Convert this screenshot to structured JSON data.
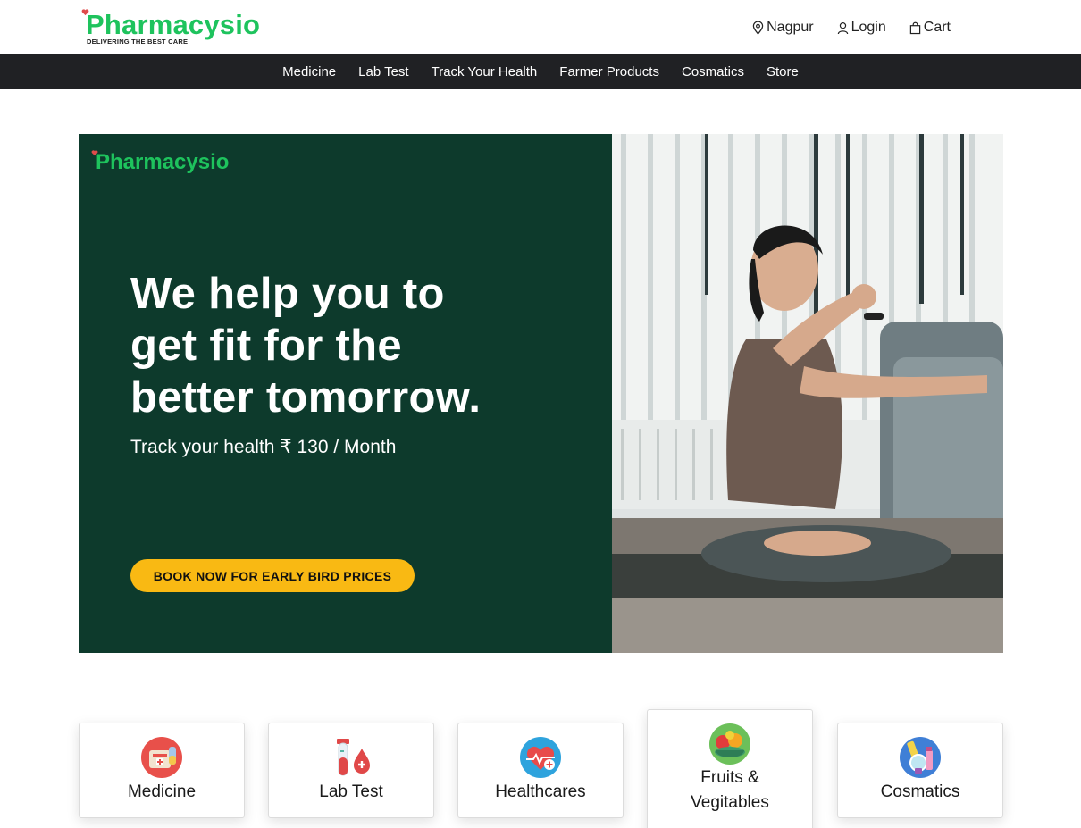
{
  "brand": {
    "name": "Pharmacysio",
    "tagline": "DELIVERING THE BEST CARE"
  },
  "top_actions": {
    "location": "Nagpur",
    "login": "Login",
    "cart": "Cart"
  },
  "nav": {
    "items": [
      "Medicine",
      "Lab Test",
      "Track Your Health",
      "Farmer Products",
      "Cosmatics",
      "Store"
    ]
  },
  "hero": {
    "logo": "Pharmacysio",
    "title_line1": "We help you to",
    "title_line2": "get fit for the",
    "title_line3": "better tomorrow.",
    "subtitle": "Track your health ₹ 130 / Month",
    "cta": "BOOK NOW FOR EARLY BIRD PRICES"
  },
  "categories": [
    {
      "label": "Medicine",
      "icon": "medicine-icon"
    },
    {
      "label": "Lab Test",
      "icon": "lab-test-icon"
    },
    {
      "label": "Healthcares",
      "icon": "healthcare-icon"
    },
    {
      "label_line1": "Fruits &",
      "label_line2": "Vegitables",
      "icon": "fruits-icon"
    },
    {
      "label": "Cosmatics",
      "icon": "cosmetics-icon"
    }
  ],
  "colors": {
    "brand_green": "#1ec35d",
    "hero_bg": "#0d3a2c",
    "nav_bg": "#202124",
    "cta_yellow": "#f9b913"
  }
}
